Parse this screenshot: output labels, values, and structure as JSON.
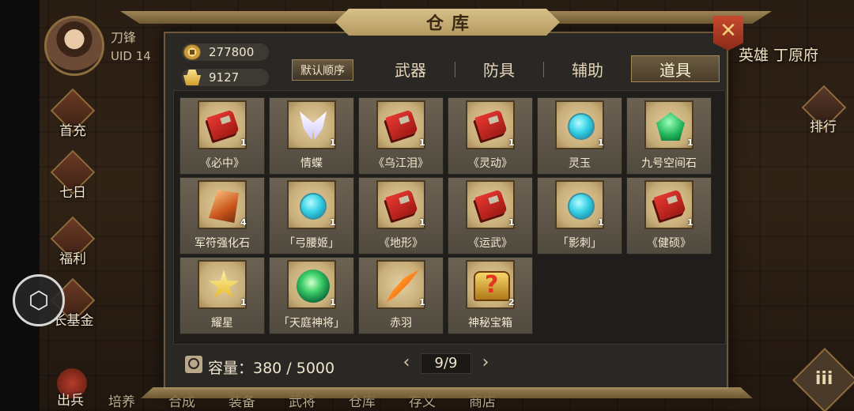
{
  "window": {
    "title": "仓库"
  },
  "player": {
    "name": "刀锋",
    "uid": "UID 14"
  },
  "scene": {
    "title": "英雄 丁原府",
    "rank_label": "排行",
    "corner_label": "iii"
  },
  "side_menu": [
    {
      "label": "首充"
    },
    {
      "label": "七日"
    },
    {
      "label": "福利"
    },
    {
      "label": "长基金"
    }
  ],
  "round_menu_icon": "cube-icon",
  "bottom_nav": {
    "out_label": "出兵",
    "items": [
      "培养",
      "合成",
      "装备",
      "武将",
      "仓库",
      "存义",
      "商店"
    ]
  },
  "currency": {
    "coins": "277800",
    "ingots": "9127"
  },
  "sort_label": "默认顺序",
  "tabs": [
    {
      "label": "武器",
      "active": false
    },
    {
      "label": "防具",
      "active": false
    },
    {
      "label": "辅助",
      "active": false
    },
    {
      "label": "道具",
      "active": true
    }
  ],
  "items": [
    {
      "name": "《必中》",
      "count": "1",
      "icon": "book-icon"
    },
    {
      "name": "情蝶",
      "count": "1",
      "icon": "butterfly"
    },
    {
      "name": "《乌江泪》",
      "count": "1",
      "icon": "book-icon"
    },
    {
      "name": "《灵动》",
      "count": "1",
      "icon": "book-icon"
    },
    {
      "name": "灵玉",
      "count": "1",
      "icon": "gem-cyan"
    },
    {
      "name": "九号空间石",
      "count": "1",
      "icon": "gem-green"
    },
    {
      "name": "军符强化石",
      "count": "4",
      "icon": "amber"
    },
    {
      "name": "「弓腰姬」",
      "count": "1",
      "icon": "gem-cyan"
    },
    {
      "name": "《地形》",
      "count": "1",
      "icon": "book-icon"
    },
    {
      "name": "《运武》",
      "count": "1",
      "icon": "book-icon"
    },
    {
      "name": "「影刺」",
      "count": "1",
      "icon": "gem-cyan"
    },
    {
      "name": "《健硕》",
      "count": "1",
      "icon": "book-icon"
    },
    {
      "name": "耀星",
      "count": "1",
      "icon": "star-icon"
    },
    {
      "name": "「天庭神将」",
      "count": "1",
      "icon": "orb-green"
    },
    {
      "name": "赤羽",
      "count": "1",
      "icon": "feather"
    },
    {
      "name": "神秘宝箱",
      "count": "2",
      "icon": "chest"
    }
  ],
  "capacity_label": "容量：380 / 5000",
  "pager": {
    "prev": "‹",
    "next": "›",
    "value": "9/9"
  },
  "colors": {
    "accent": "#a48a55",
    "panel": "#2a2825",
    "close": "#c7492f"
  }
}
